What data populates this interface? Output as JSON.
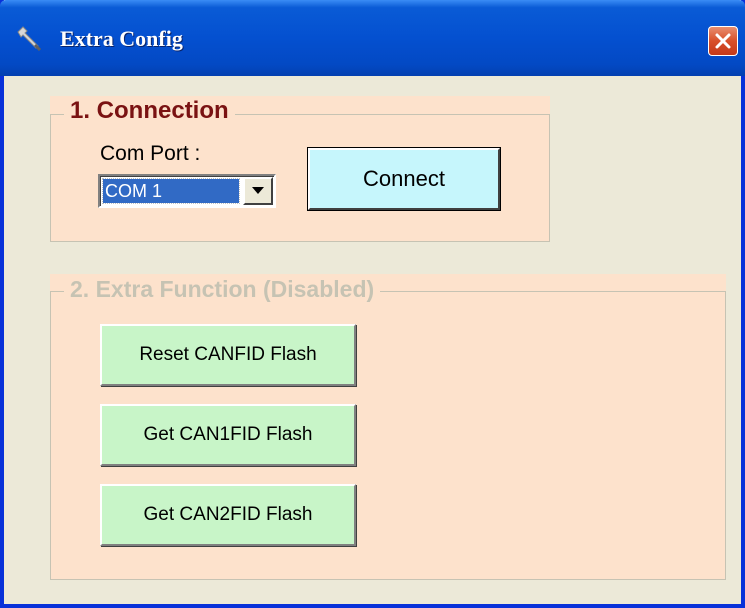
{
  "window": {
    "title": "Extra Config",
    "title_icon": "wrench-icon",
    "close_icon": "close-icon",
    "accent_color": "#0450d0",
    "close_color": "#d8502a"
  },
  "connection": {
    "legend": "1. Connection",
    "com_port_label": "Com Port :",
    "com_port_value": "COM 1",
    "connect_label": "Connect"
  },
  "extra": {
    "legend": "2. Extra Function (Disabled)",
    "buttons": [
      {
        "label": "Reset CANFID Flash"
      },
      {
        "label": "Get CAN1FID Flash"
      },
      {
        "label": "Get CAN2FID Flash"
      }
    ]
  }
}
